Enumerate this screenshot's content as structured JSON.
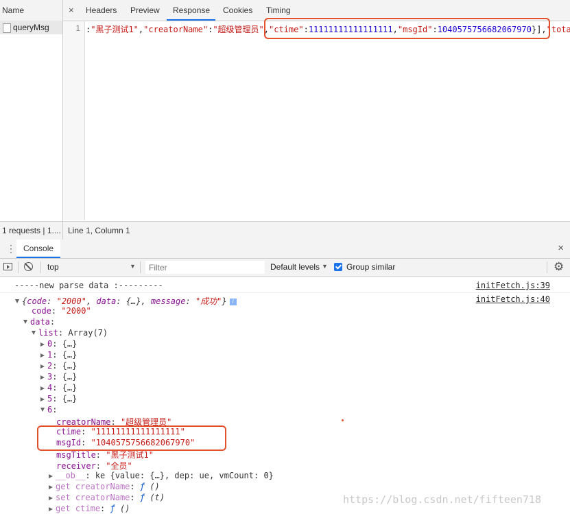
{
  "network": {
    "name_header": "Name",
    "request_name": "queryMsg",
    "tabs": [
      "Headers",
      "Preview",
      "Response",
      "Cookies",
      "Timing"
    ],
    "close_glyph": "×",
    "response": {
      "line_number": "1",
      "line_parts": [
        {
          "t": ":",
          "c": "p"
        },
        {
          "t": "\"黑子测试1\"",
          "c": "s"
        },
        {
          "t": ",",
          "c": "p"
        },
        {
          "t": "\"creatorName\"",
          "c": "s"
        },
        {
          "t": ":",
          "c": "p"
        },
        {
          "t": "\"超级管理员\"",
          "c": "s"
        },
        {
          "t": ",",
          "c": "p"
        },
        {
          "t": "\"ctime\"",
          "c": "s"
        },
        {
          "t": ":",
          "c": "p"
        },
        {
          "t": "11111111111111111",
          "c": "n"
        },
        {
          "t": ",",
          "c": "p"
        },
        {
          "t": "\"msgId\"",
          "c": "s"
        },
        {
          "t": ":",
          "c": "p"
        },
        {
          "t": "1040575756682067970",
          "c": "n"
        },
        {
          "t": "}],",
          "c": "p"
        },
        {
          "t": "\"tota",
          "c": "s"
        }
      ]
    },
    "status_left": "1 requests | 1....",
    "status_right": "Line 1, Column 1"
  },
  "drawer": {
    "tab_label": "Console",
    "close_glyph": "×"
  },
  "toolbar": {
    "context": "top",
    "filter_placeholder": "Filter",
    "levels": "Default levels",
    "group_similar": "Group similar",
    "group_similar_checked": true
  },
  "console": {
    "log1": {
      "text": "-----new parse data :---------",
      "source": "initFetch.js:39"
    },
    "log2": {
      "source": "initFetch.js:40",
      "code_val": "\"2000\"",
      "data_val": "{…}",
      "message_val": "\"成功\""
    },
    "code": {
      "key": "code",
      "value": "\"2000\""
    },
    "data_key": "data",
    "list": {
      "key": "list",
      "value": "Array(7)"
    },
    "items": [
      "0",
      "1",
      "2",
      "3",
      "4",
      "5"
    ],
    "item_value": "{…}",
    "item6": "6",
    "fields": [
      {
        "key": "creatorName",
        "value": "\"超级管理员\""
      },
      {
        "key": "ctime",
        "value": "\"11111111111111111\""
      },
      {
        "key": "msgId",
        "value": "\"1040575756682067970\""
      },
      {
        "key": "msgTitle",
        "value": "\"黑子测试1\""
      },
      {
        "key": "receiver",
        "value": "\"全员\""
      }
    ],
    "ob": {
      "key": "__ob__",
      "value": "ke {value: {…}, dep: ue, vmCount: 0}"
    },
    "accessors": [
      {
        "prefix": "get",
        "key": "creatorName",
        "sig": "()"
      },
      {
        "prefix": "set",
        "key": "creatorName",
        "sig": "(t)"
      },
      {
        "prefix": "get",
        "key": "ctime",
        "sig": "()"
      }
    ]
  },
  "watermark": "https://blog.csdn.net/fifteen718",
  "colors": {
    "highlight": "#e2512b",
    "accent": "#1a73e8"
  }
}
